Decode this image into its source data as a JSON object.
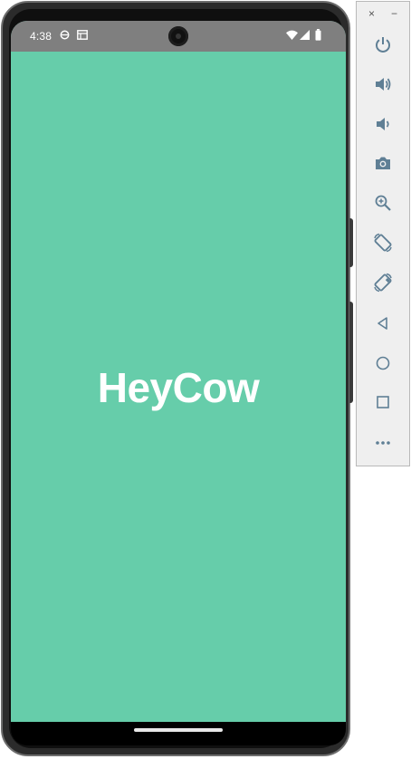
{
  "status_bar": {
    "time": "4:38",
    "left_icons": [
      "sync-icon",
      "sd-card-icon"
    ],
    "right_icons": [
      "wifi-icon",
      "signal-icon",
      "battery-icon"
    ],
    "background_color": "#7f7f7f"
  },
  "app": {
    "title": "HeyCow",
    "background_color": "#66cdaa",
    "text_color": "#ffffff"
  },
  "emulator_toolbar": {
    "window_controls": [
      {
        "name": "close-button",
        "glyph": "×"
      },
      {
        "name": "minimize-button",
        "glyph": "−"
      }
    ],
    "buttons": [
      {
        "name": "power-button",
        "icon": "power-icon"
      },
      {
        "name": "volume-up-button",
        "icon": "volume-up-icon"
      },
      {
        "name": "volume-down-button",
        "icon": "volume-down-icon"
      },
      {
        "name": "screenshot-button",
        "icon": "camera-icon"
      },
      {
        "name": "zoom-button",
        "icon": "zoom-in-icon"
      },
      {
        "name": "rotate-left-button",
        "icon": "rotate-left-icon"
      },
      {
        "name": "rotate-right-button",
        "icon": "rotate-right-icon"
      },
      {
        "name": "back-button",
        "icon": "back-triangle-icon"
      },
      {
        "name": "home-button",
        "icon": "home-circle-icon"
      },
      {
        "name": "overview-button",
        "icon": "overview-square-icon"
      },
      {
        "name": "more-button",
        "icon": "more-dots-icon"
      }
    ],
    "icon_color": "#5f7f95"
  }
}
